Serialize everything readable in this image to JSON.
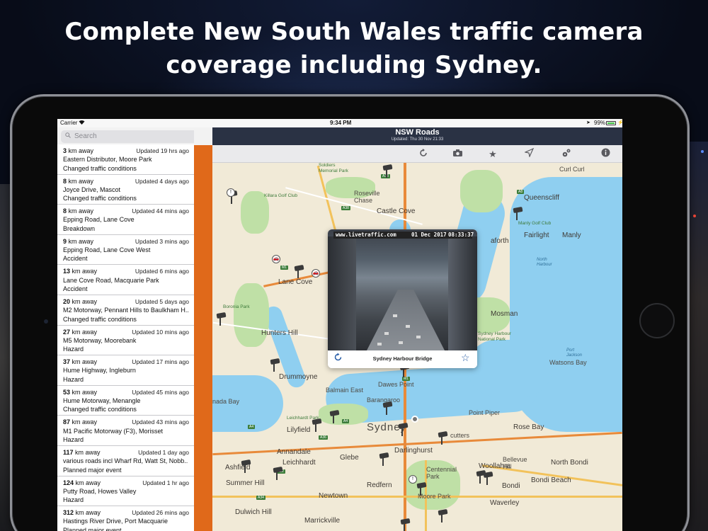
{
  "headline": {
    "line1": "Complete New South Wales traffic camera",
    "line2": "coverage including Sydney."
  },
  "status_bar": {
    "carrier": "Carrier",
    "wifi_icon": "wifi-icon",
    "time": "9:34 PM",
    "location_icon": "location-arrow-icon",
    "battery_pct": "99%",
    "battery_level": 0.99,
    "charging_icon": "bolt-icon"
  },
  "sidebar": {
    "search": {
      "placeholder": "Search"
    },
    "incidents": [
      {
        "distance_num": "3",
        "distance_unit": " km away",
        "updated": "Updated 19 hrs ago",
        "road": "Eastern Distributor, Moore Park",
        "type": "Changed traffic conditions"
      },
      {
        "distance_num": "8",
        "distance_unit": " km away",
        "updated": "Updated 4 days ago",
        "road": "Joyce Drive, Mascot",
        "type": "Changed traffic conditions"
      },
      {
        "distance_num": "8",
        "distance_unit": " km away",
        "updated": "Updated 44 mins ago",
        "road": "Epping Road, Lane Cove",
        "type": "Breakdown"
      },
      {
        "distance_num": "9",
        "distance_unit": " km away",
        "updated": "Updated 3 mins ago",
        "road": "Epping Road, Lane Cove West",
        "type": "Accident"
      },
      {
        "distance_num": "13",
        "distance_unit": " km away",
        "updated": "Updated 6 mins ago",
        "road": "Lane Cove Road, Macquarie Park",
        "type": "Accident"
      },
      {
        "distance_num": "20",
        "distance_unit": " km away",
        "updated": "Updated 5 days ago",
        "road": "M2 Motorway, Pennant Hills to Baulkham H...",
        "type": "Changed traffic conditions"
      },
      {
        "distance_num": "27",
        "distance_unit": " km away",
        "updated": "Updated 10 mins ago",
        "road": "M5 Motorway, Moorebank",
        "type": "Hazard"
      },
      {
        "distance_num": "37",
        "distance_unit": " km away",
        "updated": "Updated 17 mins ago",
        "road": "Hume Highway, Ingleburn",
        "type": "Hazard"
      },
      {
        "distance_num": "53",
        "distance_unit": " km away",
        "updated": "Updated 45 mins ago",
        "road": "Hume Motorway, Menangle",
        "type": "Changed traffic conditions"
      },
      {
        "distance_num": "87",
        "distance_unit": " km away",
        "updated": "Updated 43 mins ago",
        "road": "M1 Pacific Motorway (F3), Morisset",
        "type": "Hazard"
      },
      {
        "distance_num": "117",
        "distance_unit": " km away",
        "updated": "Updated 1 day ago",
        "road": "various roads incl Wharf Rd, Watt St, Nobb...",
        "type": "Planned major event"
      },
      {
        "distance_num": "124",
        "distance_unit": " km away",
        "updated": "Updated 1 hr ago",
        "road": "Putty Road, Howes Valley",
        "type": "Hazard"
      },
      {
        "distance_num": "312",
        "distance_unit": " km away",
        "updated": "Updated 26 mins ago",
        "road": "Hastings River Drive, Port Macquarie",
        "type": "Planned major event"
      }
    ]
  },
  "navbar": {
    "title": "NSW Roads",
    "subtitle": "Updated: Thu 30 Nov 21:33"
  },
  "toolbar": {
    "buttons": [
      "refresh-icon",
      "camera-icon",
      "star-icon",
      "navigate-icon",
      "settings-icon",
      "info-icon"
    ]
  },
  "map": {
    "labels": {
      "castle_cove": "Castle Cove",
      "roseville_chase": "Roseville\nChase",
      "queenscliff": "Queenscliff",
      "manly": "Manly",
      "fairlight": "Fairlight",
      "lane_cove": "Lane Cove",
      "mosman": "Mosman",
      "hunters_hill": "Hunters Hill",
      "drummoyne": "Drummoyne",
      "balmain_east": "Balmain East",
      "dawes_point": "Dawes Point",
      "barangaroo": "Barangaroo",
      "watsons_bay": "Watsons Bay",
      "point_piper": "Point Piper",
      "rose_bay": "Rose Bay",
      "sydney": "Sydney",
      "cutters": "cutters",
      "lilyfield": "Lilyfield",
      "annandale": "Annandale",
      "leichhardt": "Leichhardt",
      "glebe": "Glebe",
      "darlinghurst": "Darlinghurst",
      "ashfield": "Ashfield",
      "woollahra": "Woollahra",
      "bellevue_hill": "Bellevue\nHill",
      "north_bondi": "North Bondi",
      "summer_hill": "Summer Hill",
      "redfern": "Redfern",
      "bondi_beach": "Bondi Beach",
      "bondi": "Bondi",
      "newtown": "Newtown",
      "waverley": "Waverley",
      "dulwich_hill": "Dulwich Hill",
      "marrickville": "Marrickville",
      "centennial_park": "Centennial\nPark",
      "moore_park": "Moore Park",
      "nada_bay": "nada Bay",
      "seaforth": "aforth",
      "curl_curl": "Curl Curl",
      "boronia_park": "Boronia Park",
      "killara_golf": "Killara Golf Club",
      "soldiers_memorial_park": "Soldiers\nMemorial Park",
      "sydney_harbour_np": "Sydney Harbour\nNational Park",
      "manly_golf": "Manly Golf Club",
      "north_harbour": "North\nHarbour",
      "point_jackson": "Port\nJackson",
      "leichhardt_park": "Leichhardt Park"
    },
    "shields": [
      "A38",
      "A8",
      "A38",
      "M1",
      "M1",
      "A4",
      "A4",
      "A36",
      "A34",
      "A22"
    ]
  },
  "camera_popup": {
    "caption_url": "www.livetraffic.com",
    "caption_date": "01 Dec 2017",
    "caption_time": "08:33:37",
    "title": "Sydney Harbour Bridge",
    "refresh_icon": "refresh-icon",
    "favorite_icon": "star-outline-icon"
  },
  "colors": {
    "sidebar_accent": "#e0691a",
    "navbar_bg": "#2a3244",
    "tint": "#2b5fa8"
  }
}
